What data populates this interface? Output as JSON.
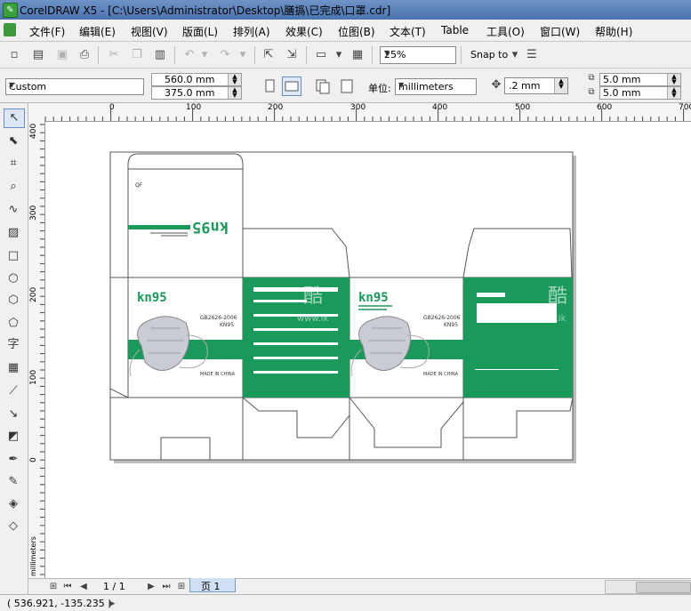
{
  "window": {
    "title": "CorelDRAW X5 - [C:\\Users\\Administrator\\Desktop\\膳撝\\已完成\\口罩.cdr]"
  },
  "menu": [
    "文件(F)",
    "编辑(E)",
    "视图(V)",
    "版面(L)",
    "排列(A)",
    "效果(C)",
    "位图(B)",
    "文本(T)",
    "Table",
    "工具(O)",
    "窗口(W)",
    "帮助(H)"
  ],
  "toolbar": {
    "zoom": "25%",
    "snap_label": "Snap to"
  },
  "property_bar": {
    "preset": "Custom",
    "width": "560.0 mm",
    "height": "375.0 mm",
    "units_label": "单位:",
    "units": "millimeters",
    "nudge": ".2 mm",
    "dup_x": "5.0 mm",
    "dup_y": "5.0 mm"
  },
  "rulers": {
    "h_ticks": [
      "0",
      "100",
      "200",
      "300",
      "400",
      "500",
      "600",
      "700"
    ],
    "v_ticks": [
      "400",
      "300",
      "200",
      "100",
      "0"
    ],
    "unit_label": "millimeters"
  },
  "design": {
    "brand": "kn95",
    "brand_flipped": "kn95",
    "standard": "GB2626-2006",
    "model": "KN95",
    "made_in": "MADE IN CHINA",
    "watermark": "酷",
    "watermark_url": "www.ik",
    "green": "#1a9a5a",
    "mark": "QF"
  },
  "navigation": {
    "page_count": "1 / 1",
    "page_tab": "页 1"
  },
  "status": {
    "coords": "( 536.921, -135.235 )"
  },
  "colors": {
    "titlebar": "#5a80bb",
    "accent_green": "#1a9a5a"
  }
}
